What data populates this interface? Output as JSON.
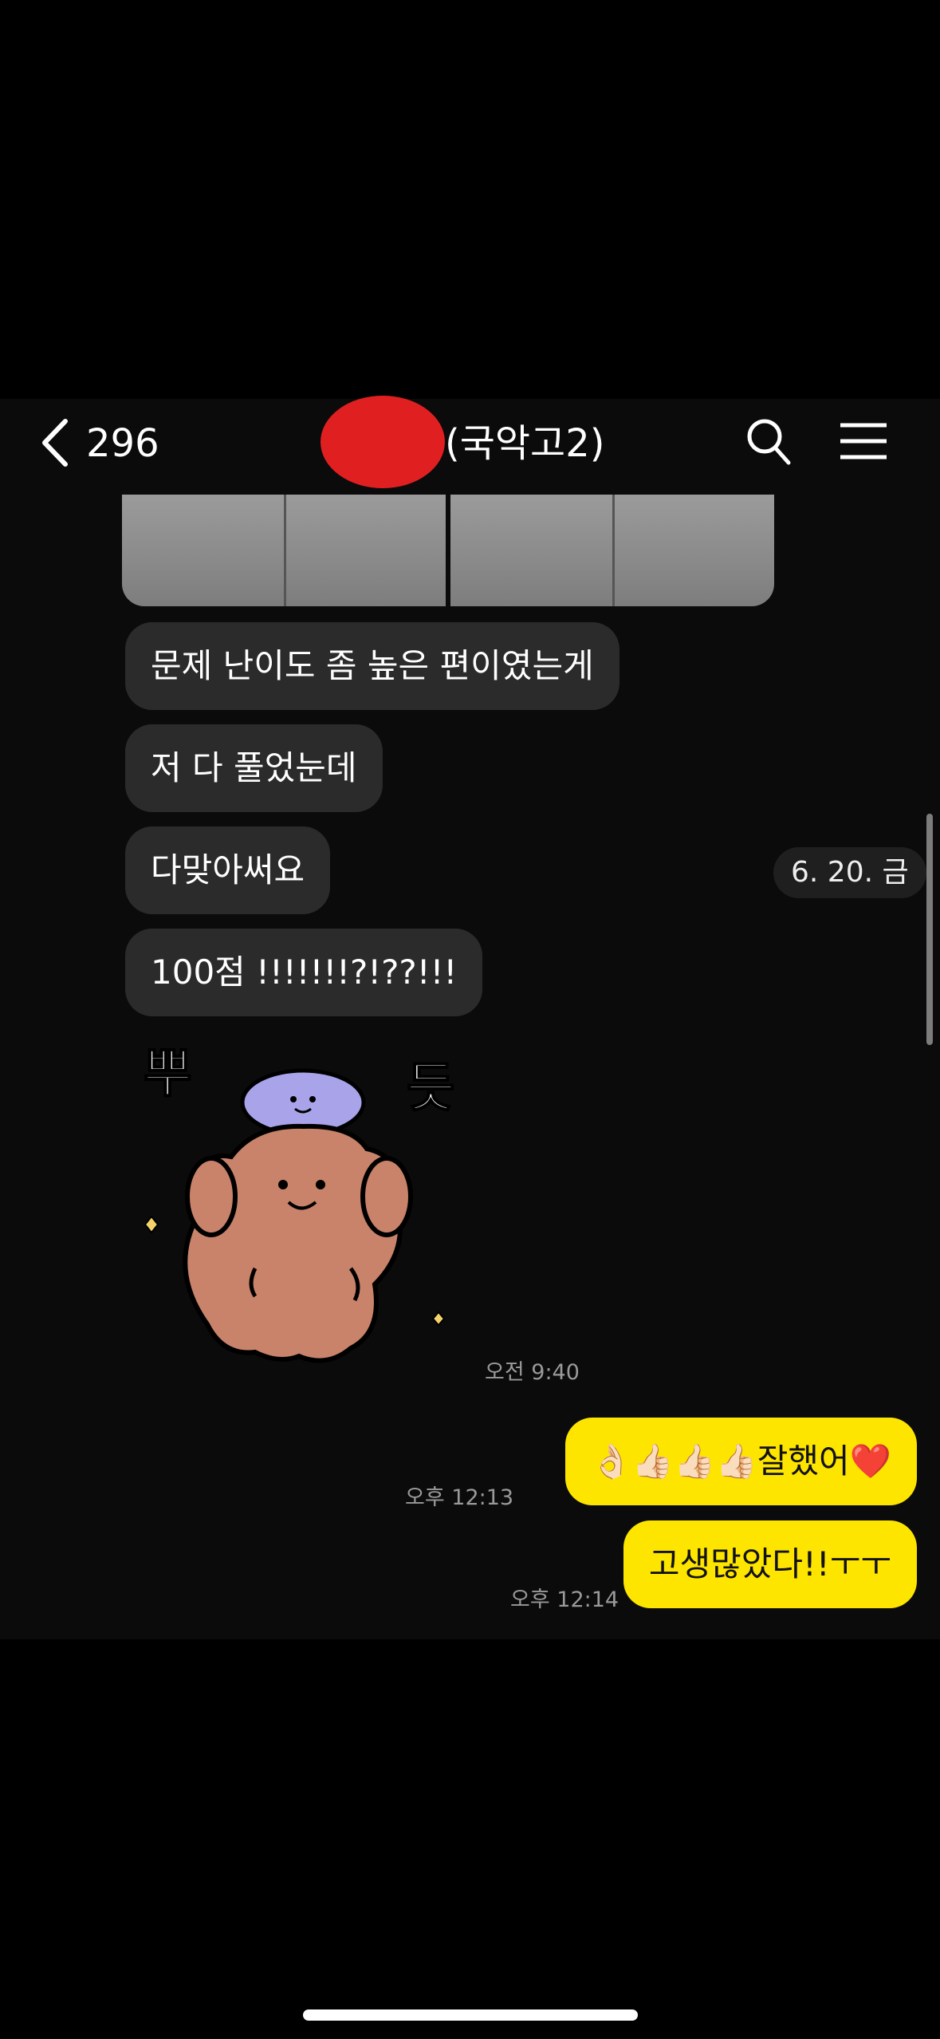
{
  "header": {
    "back_count": "296",
    "title": "(국악고2)"
  },
  "messages_in": [
    "문제 난이도 좀 높은 편이였는게",
    "저 다 풀었눈데",
    "다맞아써요",
    "100점 !!!!!!!?!??!!!"
  ],
  "sticker": {
    "text_left": "뿌",
    "text_right": "듯",
    "time": "오전 9:40"
  },
  "date_chip": "6. 20. 금",
  "messages_out": [
    {
      "text": "👌🏻👍🏻👍🏻👍🏻잘했어❤️",
      "time": "오후 12:13"
    },
    {
      "text": "고생많았다!!ㅜㅜ",
      "time": "오후 12:14"
    }
  ],
  "colors": {
    "bubble_out": "#fee500",
    "bubble_in": "#2b2b2b"
  }
}
